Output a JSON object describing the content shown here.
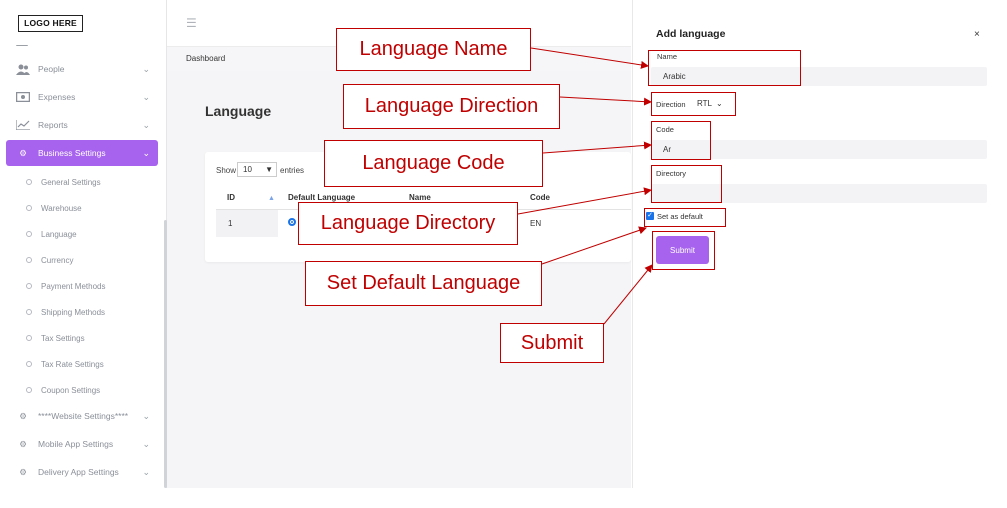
{
  "logo": "LOGO HERE",
  "sidebar": {
    "items": [
      {
        "label": "People",
        "icon": "people-icon"
      },
      {
        "label": "Expenses",
        "icon": "expenses-icon"
      },
      {
        "label": "Reports",
        "icon": "reports-icon"
      },
      {
        "label": "Business Settings",
        "icon": "gears-icon",
        "active": true
      }
    ],
    "sub_items": [
      "General Settings",
      "Warehouse",
      "Language",
      "Currency",
      "Payment Methods",
      "Shipping Methods",
      "Tax Settings",
      "Tax Rate Settings",
      "Coupon Settings"
    ],
    "lower_items": [
      "****Website Settings****",
      "Mobile App Settings",
      "Delivery App Settings"
    ]
  },
  "breadcrumb": "Dashboard",
  "page_title": "Language",
  "table": {
    "show_label": "Show",
    "entries_value": "10",
    "entries_label": "entries",
    "columns": [
      "ID",
      "Default Language",
      "Name",
      "Code"
    ],
    "rows": [
      {
        "id": "1",
        "code": "EN"
      }
    ]
  },
  "drawer": {
    "title": "Add language",
    "close": "×",
    "name_label": "Name",
    "name_value": "Arabic",
    "direction_label": "Direction",
    "direction_value": "RTL",
    "code_label": "Code",
    "code_value": "Ar",
    "directory_label": "Directory",
    "directory_value": "",
    "default_label": "Set as default",
    "default_checked": true,
    "submit_label": "Submit"
  },
  "annotations": {
    "language_name": "Language Name",
    "language_direction": "Language Direction",
    "language_code": "Language Code",
    "language_directory": "Language Directory",
    "set_default": "Set Default Language",
    "submit": "Submit"
  },
  "colors": {
    "accent": "#a763ee",
    "annotation": "#c00000",
    "checkbox": "#1a73e8"
  }
}
